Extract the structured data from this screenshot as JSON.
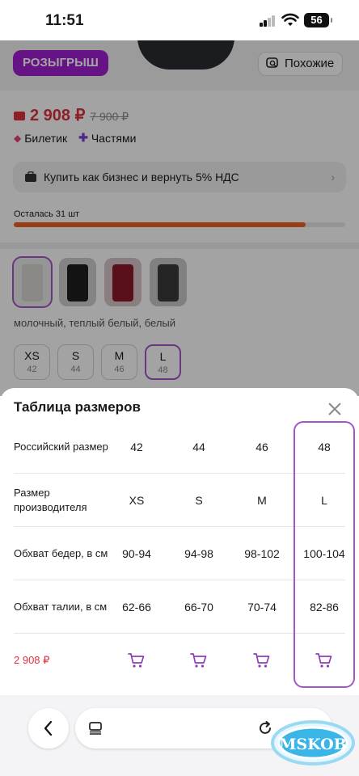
{
  "status_bar": {
    "time": "11:51",
    "battery": "56"
  },
  "product": {
    "promo_label": "РОЗЫГРЫШ",
    "similar_label": "Похожие",
    "price": "2 908 ₽",
    "old_price": "7 900 ₽",
    "tags": [
      "Билетик",
      "Частями"
    ],
    "business_offer": "Купить как бизнес и вернуть 5% НДС",
    "stock_text": "Осталась 31 шт",
    "stock_fill_percent": 88,
    "swatch_colors": [
      "#d8d6d0",
      "#1e1e20",
      "#8e1a2a",
      "#3a3a3c"
    ],
    "colors_text": "молочный, теплый белый, белый",
    "sizes": [
      {
        "letter": "XS",
        "num": "42"
      },
      {
        "letter": "S",
        "num": "44"
      },
      {
        "letter": "M",
        "num": "46"
      },
      {
        "letter": "L",
        "num": "48"
      }
    ],
    "selected_size": "L"
  },
  "size_table": {
    "title": "Таблица размеров",
    "rows": [
      {
        "label": "Российский размер",
        "values": [
          "42",
          "44",
          "46",
          "48"
        ]
      },
      {
        "label": "Размер производителя",
        "values": [
          "XS",
          "S",
          "M",
          "L"
        ]
      },
      {
        "label": "Обхват бедер, в см",
        "values": [
          "90-94",
          "94-98",
          "98-102",
          "100-104"
        ]
      },
      {
        "label": "Обхват талии, в см",
        "values": [
          "62-66",
          "66-70",
          "70-74",
          "82-86"
        ]
      }
    ],
    "price_label": "2 908 ₽"
  },
  "colors": {
    "accent": "#a356c9",
    "price_red": "#e0313d",
    "promo": "#a01fd0"
  },
  "watermark": "MSKOB"
}
